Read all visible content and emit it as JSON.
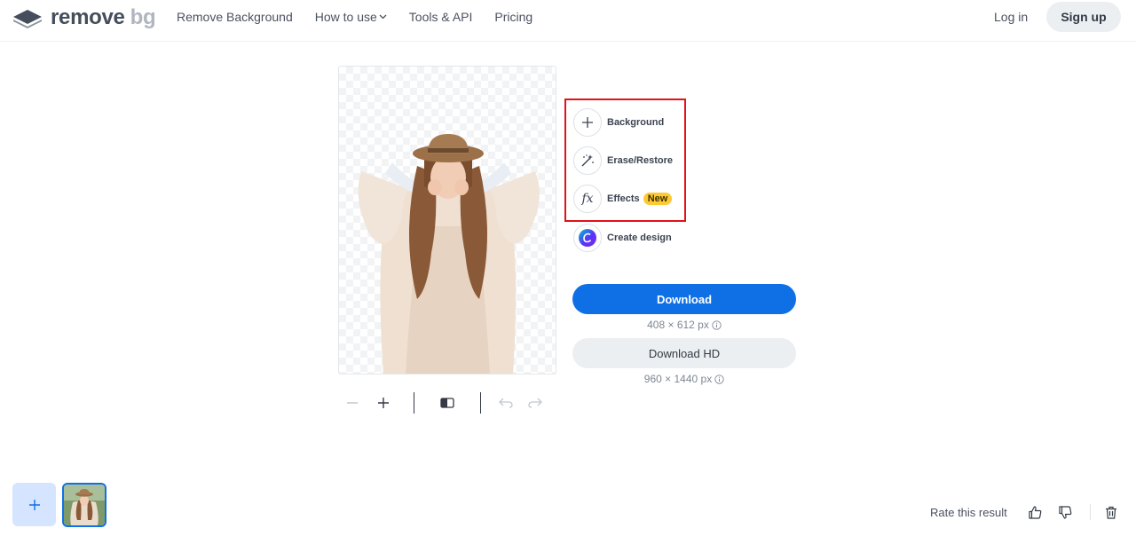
{
  "brand": {
    "name_part1": "remove",
    "name_part2": "bg"
  },
  "nav": {
    "items": [
      "Remove Background",
      "How to use",
      "Tools & API",
      "Pricing"
    ],
    "login": "Log in",
    "signup": "Sign up"
  },
  "tools": {
    "background": "Background",
    "erase_restore": "Erase/Restore",
    "effects": "Effects",
    "effects_badge": "New",
    "create_design": "Create design"
  },
  "download": {
    "label": "Download",
    "size": "408 × 612 px",
    "hd_label": "Download HD",
    "hd_size": "960 × 1440 px"
  },
  "footer": {
    "rate_label": "Rate this result"
  },
  "colors": {
    "primary": "#0f70e6",
    "highlight": "#e0121a",
    "badge": "#ffc934",
    "add_bg": "#d6e5ff"
  },
  "icons": [
    "logo-icon",
    "chevron-down-icon",
    "zoom-out-icon",
    "zoom-in-icon",
    "compare-icon",
    "undo-icon",
    "redo-icon",
    "plus-icon",
    "magic-wand-icon",
    "fx-icon",
    "canva-icon",
    "info-icon",
    "thumbs-up-icon",
    "thumbs-down-icon",
    "trash-icon"
  ]
}
